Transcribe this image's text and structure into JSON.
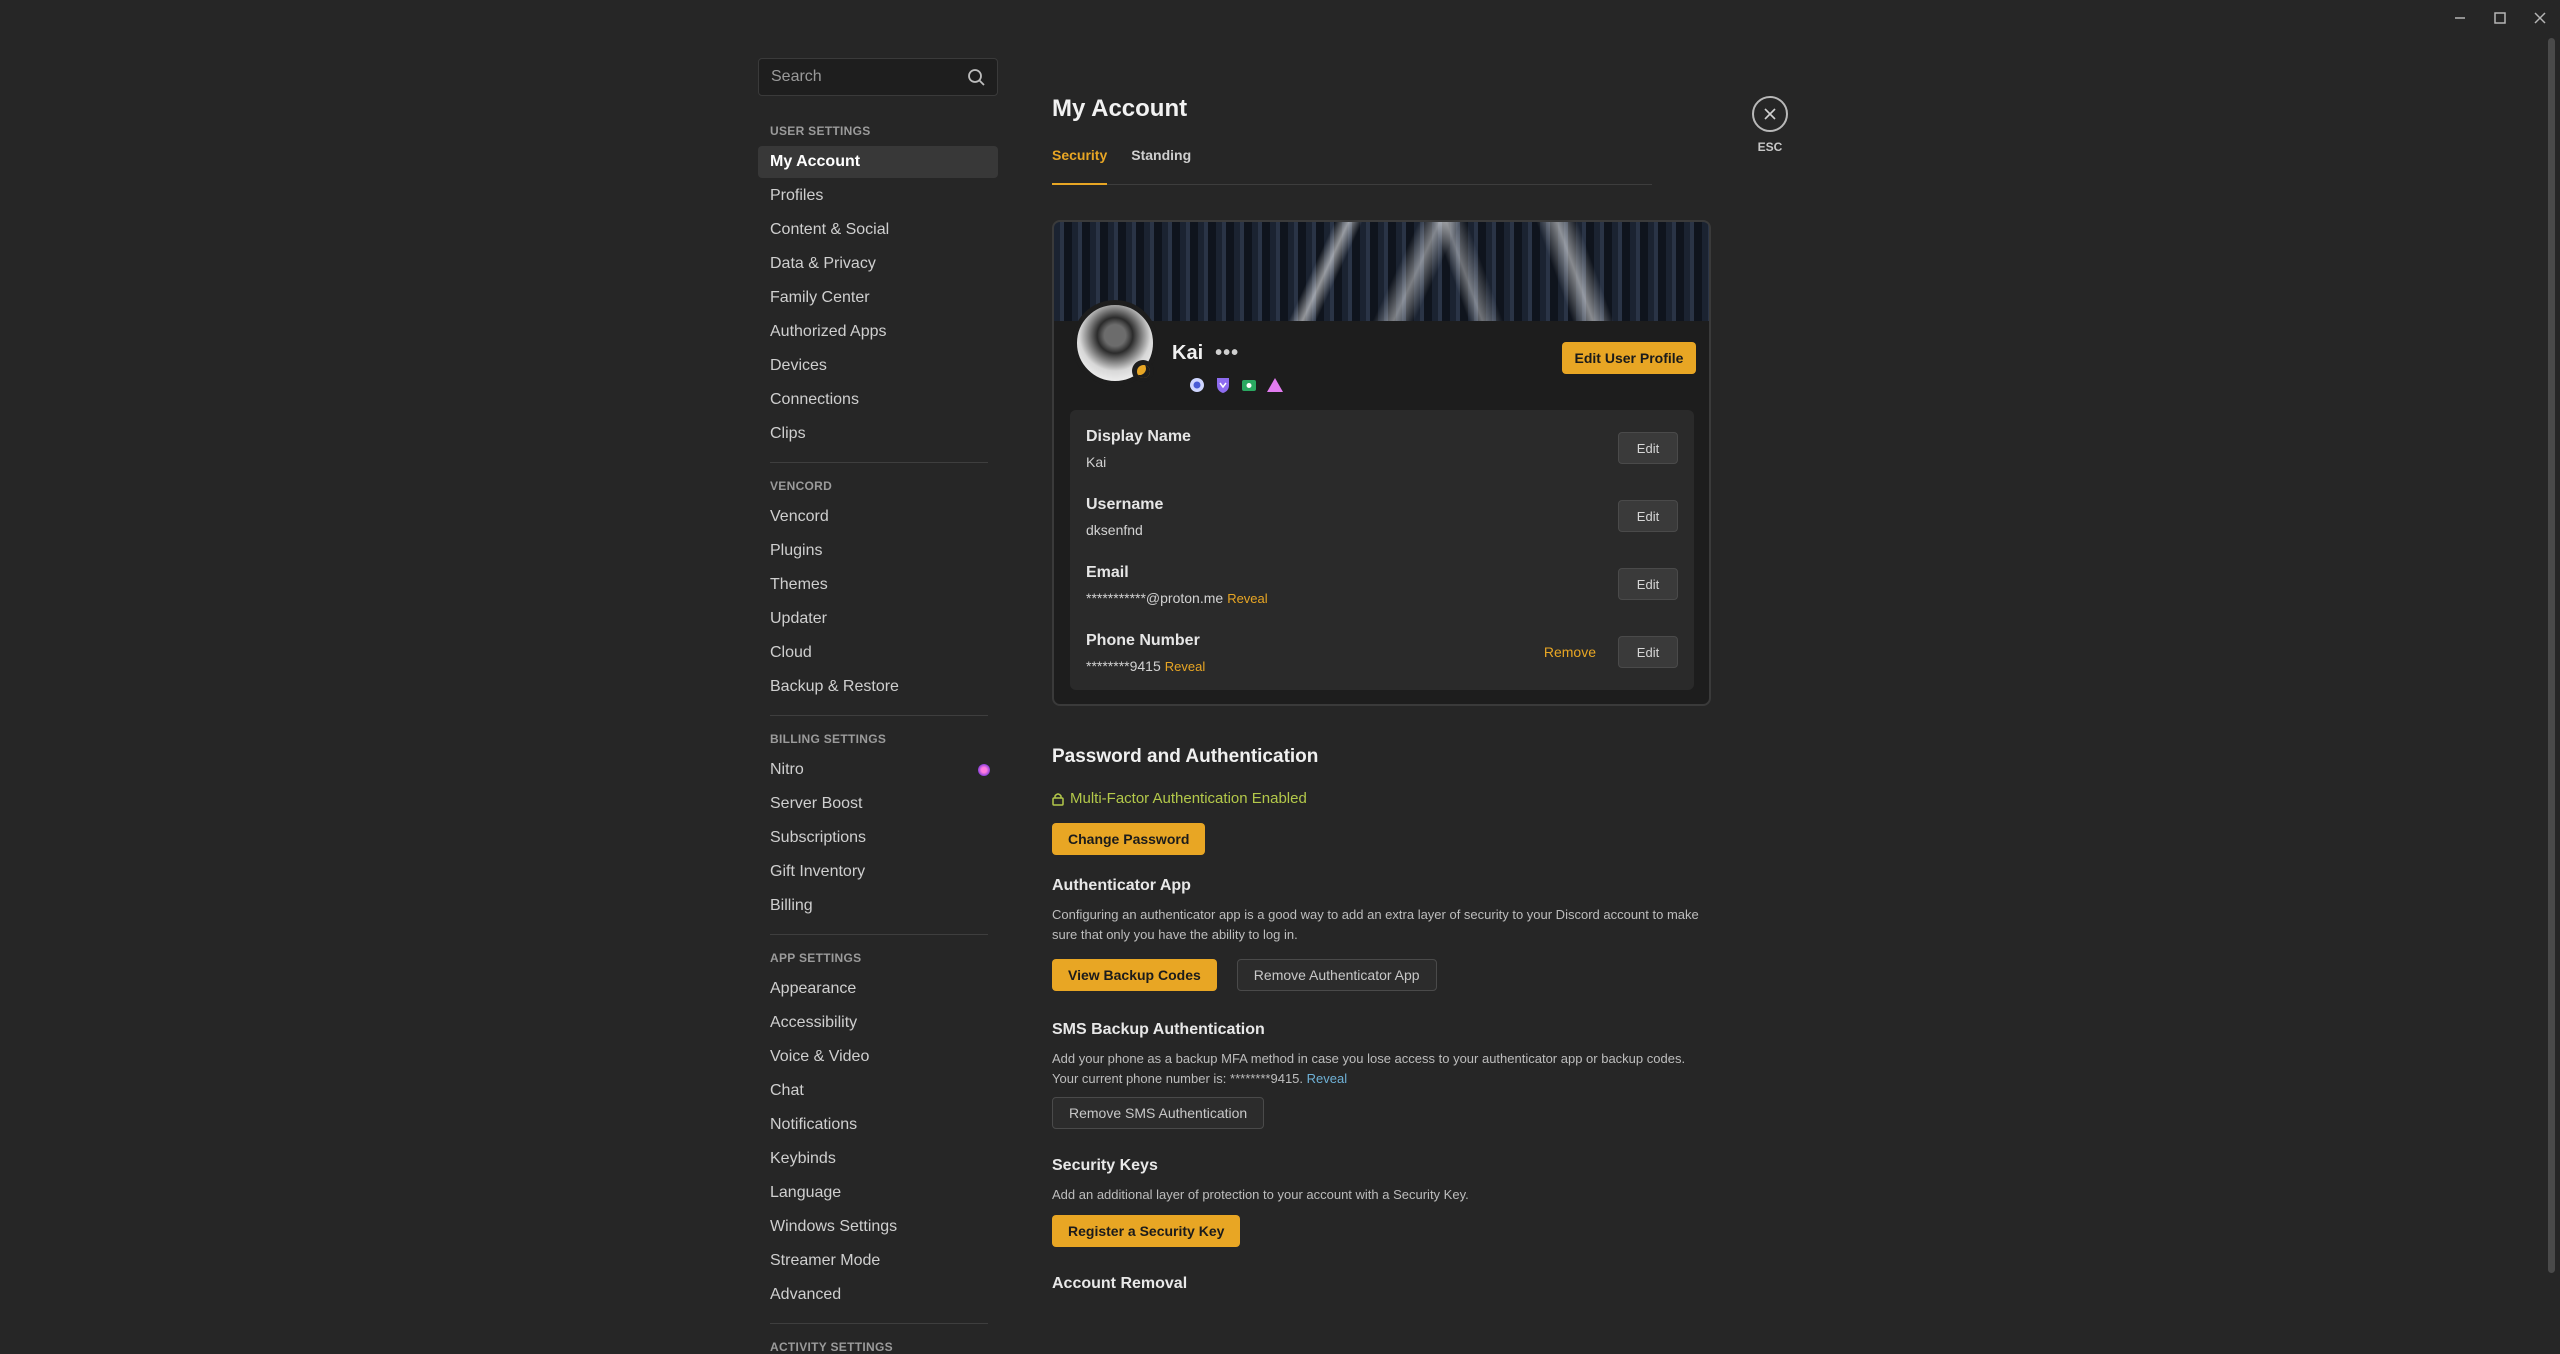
{
  "window": {
    "minimize": "–",
    "maximize": "□",
    "close": "✕"
  },
  "search": {
    "placeholder": "Search"
  },
  "sidebar": {
    "user_settings_header": "USER SETTINGS",
    "user_settings": [
      "My Account",
      "Profiles",
      "Content & Social",
      "Data & Privacy",
      "Family Center",
      "Authorized Apps",
      "Devices",
      "Connections",
      "Clips"
    ],
    "vencord_header": "VENCORD",
    "vencord": [
      "Vencord",
      "Plugins",
      "Themes",
      "Updater",
      "Cloud",
      "Backup & Restore"
    ],
    "billing_header": "BILLING SETTINGS",
    "billing": [
      "Nitro",
      "Server Boost",
      "Subscriptions",
      "Gift Inventory",
      "Billing"
    ],
    "app_header": "APP SETTINGS",
    "app": [
      "Appearance",
      "Accessibility",
      "Voice & Video",
      "Chat",
      "Notifications",
      "Keybinds",
      "Language",
      "Windows Settings",
      "Streamer Mode",
      "Advanced"
    ],
    "activity_header": "ACTIVITY SETTINGS"
  },
  "main": {
    "title": "My Account",
    "tabs": [
      "Security",
      "Standing"
    ],
    "esc_label": "ESC"
  },
  "profile": {
    "display_name": "Kai",
    "more": "•••",
    "edit_profile": "Edit User Profile",
    "rows": [
      {
        "label": "Display Name",
        "value": "Kai",
        "edit": "Edit"
      },
      {
        "label": "Username",
        "value": "dksenfnd",
        "edit": "Edit"
      },
      {
        "label": "Email",
        "value": "***********@proton.me",
        "reveal": "Reveal",
        "edit": "Edit"
      },
      {
        "label": "Phone Number",
        "value": "********9415",
        "reveal": "Reveal",
        "remove": "Remove",
        "edit": "Edit"
      }
    ]
  },
  "auth": {
    "title": "Password and Authentication",
    "mfa_status": "Multi-Factor Authentication Enabled",
    "change_password": "Change Password",
    "app_title": "Authenticator App",
    "app_desc": "Configuring an authenticator app is a good way to add an extra layer of security to your Discord account to make sure that only you have the ability to log in.",
    "view_backup": "View Backup Codes",
    "remove_app": "Remove Authenticator App",
    "sms_title": "SMS Backup Authentication",
    "sms_desc": "Add your phone as a backup MFA method in case you lose access to your authenticator app or backup codes. Your current phone number is: ********9415.",
    "sms_reveal": "Reveal",
    "remove_sms": "Remove SMS Authentication",
    "keys_title": "Security Keys",
    "keys_desc": "Add an additional layer of protection to your account with a Security Key.",
    "register_key": "Register a Security Key",
    "removal_title": "Account Removal"
  },
  "colors": {
    "accent": "#e8a624",
    "background": "#262626",
    "mfa_green": "#b3c84a"
  }
}
